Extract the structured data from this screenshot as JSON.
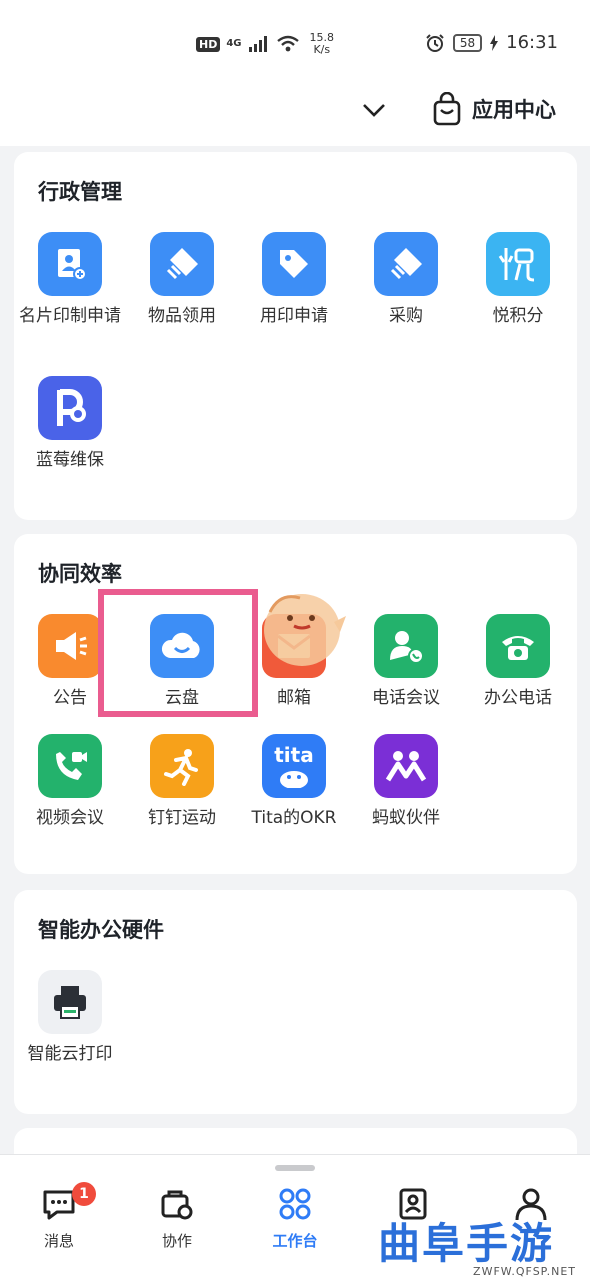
{
  "status_bar": {
    "hd": "HD",
    "network": "4G",
    "speed_value": "15.8",
    "speed_unit": "K/s",
    "battery": "58",
    "time": "16:31"
  },
  "header": {
    "chevron_icon": "chevron-down-icon",
    "app_center_label": "应用中心",
    "app_center_icon": "shopping-bag-icon"
  },
  "sections": [
    {
      "title": "行政管理",
      "items": [
        {
          "label": "名片印制申请",
          "icon": "business-card-icon",
          "color": "#3d8ef6"
        },
        {
          "label": "物品领用",
          "icon": "items-icon",
          "color": "#3d8ef6"
        },
        {
          "label": "用印申请",
          "icon": "tag-icon",
          "color": "#3d8ef6"
        },
        {
          "label": "采购",
          "icon": "purchase-icon",
          "color": "#3d8ef6"
        },
        {
          "label": "悦积分",
          "icon": "points-icon",
          "color": "#3bb4f2"
        },
        {
          "label": "蓝莓维保",
          "icon": "blueberry-icon",
          "color": "#4a63e8"
        }
      ]
    },
    {
      "title": "协同效率",
      "items": [
        {
          "label": "公告",
          "icon": "megaphone-icon",
          "color": "#f98a2e"
        },
        {
          "label": "云盘",
          "icon": "cloud-icon",
          "color": "#3d8ef6"
        },
        {
          "label": "邮箱",
          "icon": "mail-icon",
          "color": "#f05a3a"
        },
        {
          "label": "电话会议",
          "icon": "conference-call-icon",
          "color": "#23b26c"
        },
        {
          "label": "办公电话",
          "icon": "office-phone-icon",
          "color": "#23b26c"
        },
        {
          "label": "视频会议",
          "icon": "video-call-icon",
          "color": "#23b26c"
        },
        {
          "label": "钉钉运动",
          "icon": "running-icon",
          "color": "#f7a11a"
        },
        {
          "label": "Tita的OKR",
          "icon": "tita-icon",
          "color": "#2f7cf6"
        },
        {
          "label": "蚂蚁伙伴",
          "icon": "ant-partner-icon",
          "color": "#7b2fd6"
        }
      ]
    },
    {
      "title": "智能办公硬件",
      "items": [
        {
          "label": "智能云打印",
          "icon": "printer-icon",
          "color": "#eef0f3"
        }
      ]
    }
  ],
  "tita_text": "tita",
  "bottom_nav": [
    {
      "label": "消息",
      "icon": "message-icon",
      "badge": "1"
    },
    {
      "label": "协作",
      "icon": "collaboration-icon"
    },
    {
      "label": "工作台",
      "icon": "workbench-icon",
      "active": true
    },
    {
      "label": "",
      "icon": "contacts-icon"
    },
    {
      "label": "",
      "icon": "profile-icon"
    }
  ],
  "watermark": {
    "main": "曲阜手游网",
    "sub": "ZWFW.QFSP.NET"
  },
  "colors": {
    "accent": "#2f7cf6",
    "highlight": "#ea5c8f",
    "badge": "#f04b3c"
  }
}
